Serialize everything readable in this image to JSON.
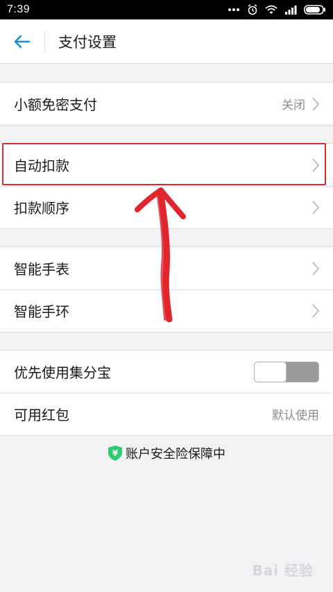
{
  "status_bar": {
    "time": "7:39"
  },
  "header": {
    "title": "支付设置"
  },
  "groups": [
    {
      "rows": [
        {
          "label": "小额免密支付",
          "value": "关闭"
        }
      ]
    },
    {
      "rows": [
        {
          "label": "自动扣款"
        },
        {
          "label": "扣款顺序"
        }
      ]
    },
    {
      "rows": [
        {
          "label": "智能手表"
        },
        {
          "label": "智能手环"
        }
      ]
    },
    {
      "rows": [
        {
          "label": "优先使用集分宝",
          "toggle": false
        },
        {
          "label": "可用红包",
          "value": "默认使用"
        }
      ]
    }
  ],
  "footer": {
    "safety_text": "账户安全险保障中",
    "shield_glyph": "¥"
  },
  "watermark": "Bai 经验",
  "colors": {
    "accent": "#1a8dd6",
    "highlight": "#e0262d",
    "shield": "#2ecc71"
  }
}
